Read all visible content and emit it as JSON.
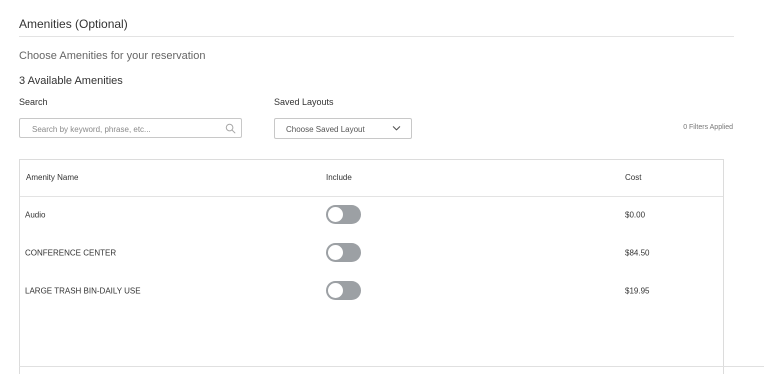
{
  "section": {
    "title": "Amenities (Optional)",
    "subtitle": "Choose Amenities for your reservation",
    "available_count": "3 Available Amenities"
  },
  "search": {
    "label": "Search",
    "placeholder": "Search by keyword, phrase, etc...",
    "value": ""
  },
  "saved_layouts": {
    "label": "Saved Layouts",
    "selected": "Choose Saved Layout"
  },
  "filters_applied": "0 Filters Applied",
  "table": {
    "headers": [
      "Amenity Name",
      "Include",
      "Cost"
    ],
    "rows": [
      {
        "name": "Audio",
        "include": false,
        "cost": "$0.00"
      },
      {
        "name": "CONFERENCE CENTER",
        "include": false,
        "cost": "$84.50"
      },
      {
        "name": "LARGE TRASH BIN-DAILY USE",
        "include": false,
        "cost": "$19.95"
      }
    ]
  },
  "colors": {
    "toggle_off": "#9ca0a4",
    "border": "#c8c8c8"
  },
  "icons": {
    "search": "search-icon",
    "dropdown": "chevron-down-icon"
  }
}
